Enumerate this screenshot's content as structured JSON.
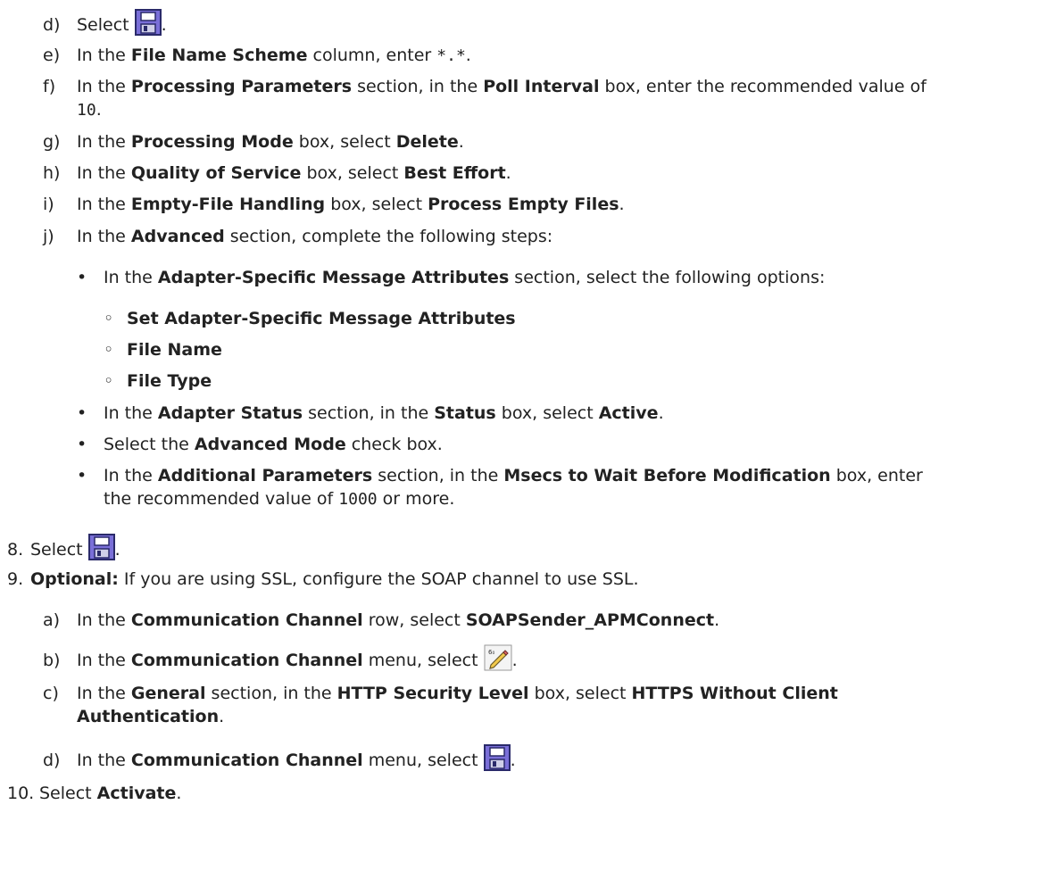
{
  "doc": {
    "d1": {
      "marker": "d)",
      "t": "Select",
      "p": "."
    },
    "e": {
      "marker": "e)",
      "t0": "In the ",
      "b0": "File Name Scheme",
      "t1": " column, enter ",
      "code": "*.*",
      "p": "."
    },
    "f": {
      "marker": "f)",
      "t0": "In the ",
      "b0": "Processing Parameters",
      "t1": " section, in the ",
      "b1": "Poll Interval",
      "t2": " box, enter the recommended value of",
      "code": "10",
      "p": "."
    },
    "g": {
      "marker": "g)",
      "t0": "In the ",
      "b0": "Processing Mode",
      "t1": " box, select ",
      "b1": "Delete",
      "p": "."
    },
    "h": {
      "marker": "h)",
      "t0": "In the ",
      "b0": "Quality of Service",
      "t1": " box, select ",
      "b1": "Best Effort",
      "p": "."
    },
    "i": {
      "marker": "i)",
      "t0": "In the ",
      "b0": "Empty-File Handling",
      "t1": " box, select ",
      "b1": "Process Empty Files",
      "p": "."
    },
    "j": {
      "marker": "j)",
      "t0": "In the ",
      "b0": "Advanced",
      "t1": " section, complete the following steps:"
    },
    "b1": {
      "t0": "In the ",
      "b0": "Adapter-Specific Message Attributes",
      "t1": " section, select the following options:"
    },
    "o1": "Set Adapter-Specific Message Attributes",
    "o2": "File Name",
    "o3": "File Type",
    "b2": {
      "t0": "In the ",
      "b0": "Adapter Status",
      "t1": " section, in the ",
      "b1": "Status",
      "t2": " box, select ",
      "b2": "Active",
      "p": "."
    },
    "b3": {
      "t0": "Select the ",
      "b0": "Advanced Mode",
      "t1": " check box."
    },
    "b4": {
      "t0": "In the ",
      "b0": "Additional Parameters",
      "t1": " section, in the ",
      "b1": "Msecs to Wait Before Modification",
      "t2": " box, enter",
      "t3": "the recommended value of ",
      "code": "1000",
      "t4": " or more."
    },
    "s8": {
      "marker": "8.",
      "t": "Select",
      "p": "."
    },
    "s9": {
      "marker": "9.",
      "b0": "Optional:",
      "t0": " If you are using SSL, configure the SOAP channel to use SSL."
    },
    "a9": {
      "marker": "a)",
      "t0": "In the ",
      "b0": "Communication Channel",
      "t1": " row, select ",
      "b1": "SOAPSender_APMConnect",
      "p": "."
    },
    "b9": {
      "marker": "b)",
      "t0": "In the ",
      "b0": "Communication Channel",
      "t1": " menu, select",
      "p": "."
    },
    "c9": {
      "marker": "c)",
      "t0": "In the ",
      "b0": "General",
      "t1": " section, in the ",
      "b1": "HTTP Security Level",
      "t2": " box, select ",
      "b2": "HTTPS Without Client",
      "b3": "Authentication",
      "p": "."
    },
    "d9": {
      "marker": "d)",
      "t0": "In the ",
      "b0": "Communication Channel",
      "t1": " menu, select",
      "p": "."
    },
    "s10": {
      "marker": "10.",
      "t0": "Select ",
      "b0": "Activate",
      "p": "."
    },
    "icons": {
      "save": "save-icon",
      "edit": "edit-pencil-icon"
    },
    "colors": {
      "save_icon_fill": "#7a6fd8",
      "text": "#222222"
    }
  }
}
